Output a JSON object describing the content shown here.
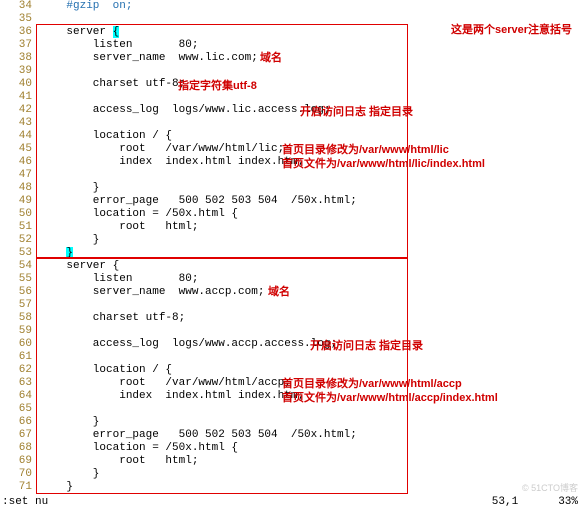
{
  "lines": [
    {
      "n": "34",
      "code": "    #gzip  on;",
      "cls": "comment"
    },
    {
      "n": "35",
      "code": ""
    },
    {
      "n": "36",
      "code": "    server ",
      "brace_open": true
    },
    {
      "n": "37",
      "code": "        listen       80;"
    },
    {
      "n": "38",
      "code": "        server_name  www.lic.com;"
    },
    {
      "n": "39",
      "code": ""
    },
    {
      "n": "40",
      "code": "        charset utf-8;"
    },
    {
      "n": "41",
      "code": ""
    },
    {
      "n": "42",
      "code": "        access_log  logs/www.lic.access.log;"
    },
    {
      "n": "43",
      "code": ""
    },
    {
      "n": "44",
      "code": "        location / {"
    },
    {
      "n": "45",
      "code": "            root   /var/www/html/lic;"
    },
    {
      "n": "46",
      "code": "            index  index.html index.htm;"
    },
    {
      "n": "47",
      "code": ""
    },
    {
      "n": "48",
      "code": "        }"
    },
    {
      "n": "49",
      "code": "        error_page   500 502 503 504  /50x.html;"
    },
    {
      "n": "50",
      "code": "        location = /50x.html {"
    },
    {
      "n": "51",
      "code": "            root   html;"
    },
    {
      "n": "52",
      "code": "        }"
    },
    {
      "n": "53",
      "code": "    ",
      "brace_close": true
    },
    {
      "n": "54",
      "code": "    server {"
    },
    {
      "n": "55",
      "code": "        listen       80;"
    },
    {
      "n": "56",
      "code": "        server_name  www.accp.com;"
    },
    {
      "n": "57",
      "code": ""
    },
    {
      "n": "58",
      "code": "        charset utf-8;"
    },
    {
      "n": "59",
      "code": ""
    },
    {
      "n": "60",
      "code": "        access_log  logs/www.accp.access.log;"
    },
    {
      "n": "61",
      "code": ""
    },
    {
      "n": "62",
      "code": "        location / {"
    },
    {
      "n": "63",
      "code": "            root   /var/www/html/accp;"
    },
    {
      "n": "64",
      "code": "            index  index.html index.htm;"
    },
    {
      "n": "65",
      "code": ""
    },
    {
      "n": "66",
      "code": "        }"
    },
    {
      "n": "67",
      "code": "        error_page   500 502 503 504  /50x.html;"
    },
    {
      "n": "68",
      "code": "        location = /50x.html {"
    },
    {
      "n": "69",
      "code": "            root   html;"
    },
    {
      "n": "70",
      "code": "        }"
    },
    {
      "n": "71",
      "code": "    }"
    }
  ],
  "annotations": {
    "top_right": "这是两个server注意括号",
    "domain1": "域名",
    "charset1": "指定字符集utf-8",
    "log1": "开启访问日志  指定目录",
    "root1a": "首页目录修改为/var/www/html/lic",
    "root1b": "首页文件为/var/www/html/lic/index.html",
    "domain2": "域名",
    "log2": "开启访问日志  指定目录",
    "root2a": "首页目录修改为/var/www/html/accp",
    "root2b": "首页文件为/var/www/html/accp/index.html"
  },
  "status": {
    "left": ":set nu",
    "pos": "53,1",
    "pct": "33%"
  },
  "watermark": "© 51CTO博客"
}
